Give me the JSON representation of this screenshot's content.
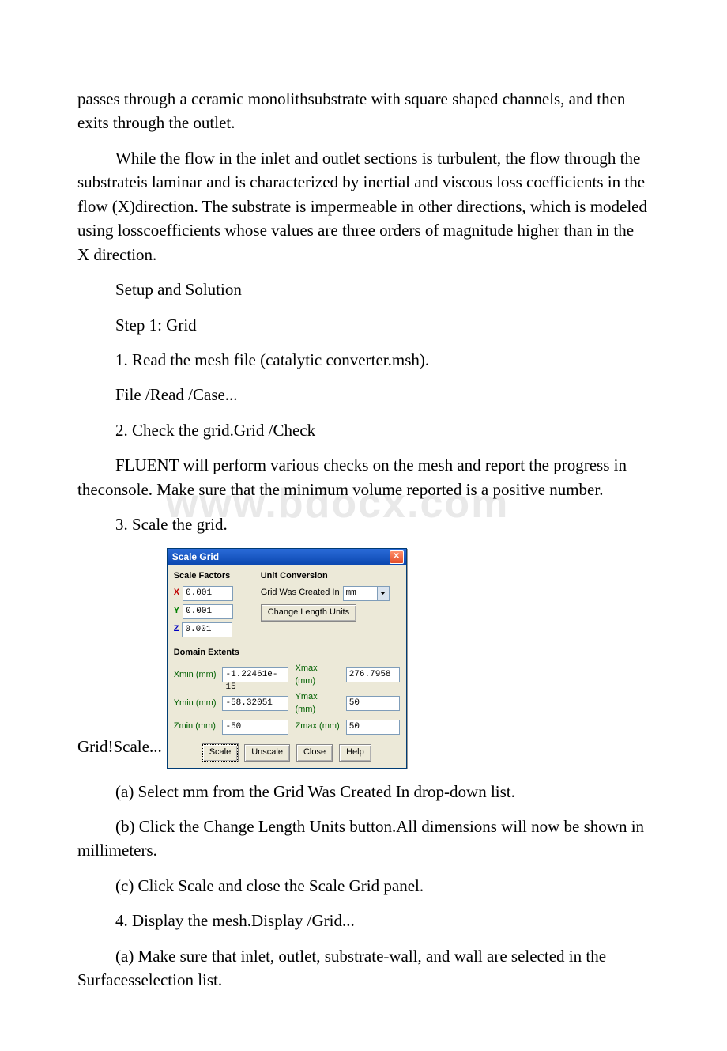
{
  "watermark": "www.bdocx.com",
  "paragraphs": {
    "p1": "passes through a ceramic monolithsubstrate with square shaped channels, and then exits through the outlet.",
    "p2": "While the flow in the inlet and outlet sections is turbulent, the flow through the substrateis laminar and is characterized by inertial and viscous loss coefficients in the flow (X)direction. The substrate is impermeable in other directions, which is modeled using losscoefficients whose values are three orders of magnitude higher than in the X direction.",
    "p3": "Setup and Solution",
    "p4": "Step 1: Grid",
    "p5": "1. Read the mesh file (catalytic converter.msh).",
    "p6": "File /Read /Case...",
    "p7": "2. Check the grid.Grid /Check",
    "p8": "FLUENT will perform various checks on the mesh and report the progress in theconsole. Make sure that the minimum volume reported is a positive number.",
    "p9": "3. Scale the grid.",
    "p10_prefix": "Grid!Scale...",
    "p11": "(a) Select mm from the Grid Was Created In drop-down list.",
    "p12": "(b) Click the Change Length Units button.All dimensions will now be shown in millimeters.",
    "p13": "(c) Click Scale and close the Scale Grid panel.",
    "p14": "4. Display the mesh.Display /Grid...",
    "p15": "(a) Make sure that inlet, outlet, substrate-wall, and wall are selected in the Surfacesselection list."
  },
  "dialog": {
    "title": "Scale Grid",
    "close_icon": "✕",
    "scale_factors": {
      "label": "Scale Factors",
      "x_label": "X",
      "y_label": "Y",
      "z_label": "Z",
      "x": "0.001",
      "y": "0.001",
      "z": "0.001"
    },
    "unit_conversion": {
      "label": "Unit Conversion",
      "created_in_label": "Grid Was Created In",
      "created_in_value": "mm",
      "change_units_label": "Change Length Units"
    },
    "domain_extents": {
      "label": "Domain Extents",
      "xmin_label": "Xmin (mm)",
      "xmin": "-1.22461e-15",
      "xmax_label": "Xmax (mm)",
      "xmax": "276.7958",
      "ymin_label": "Ymin (mm)",
      "ymin": "-58.32051",
      "ymax_label": "Ymax (mm)",
      "ymax": "50",
      "zmin_label": "Zmin (mm)",
      "zmin": "-50",
      "zmax_label": "Zmax (mm)",
      "zmax": "50"
    },
    "buttons": {
      "scale": "Scale",
      "unscale": "Unscale",
      "close": "Close",
      "help": "Help"
    }
  }
}
